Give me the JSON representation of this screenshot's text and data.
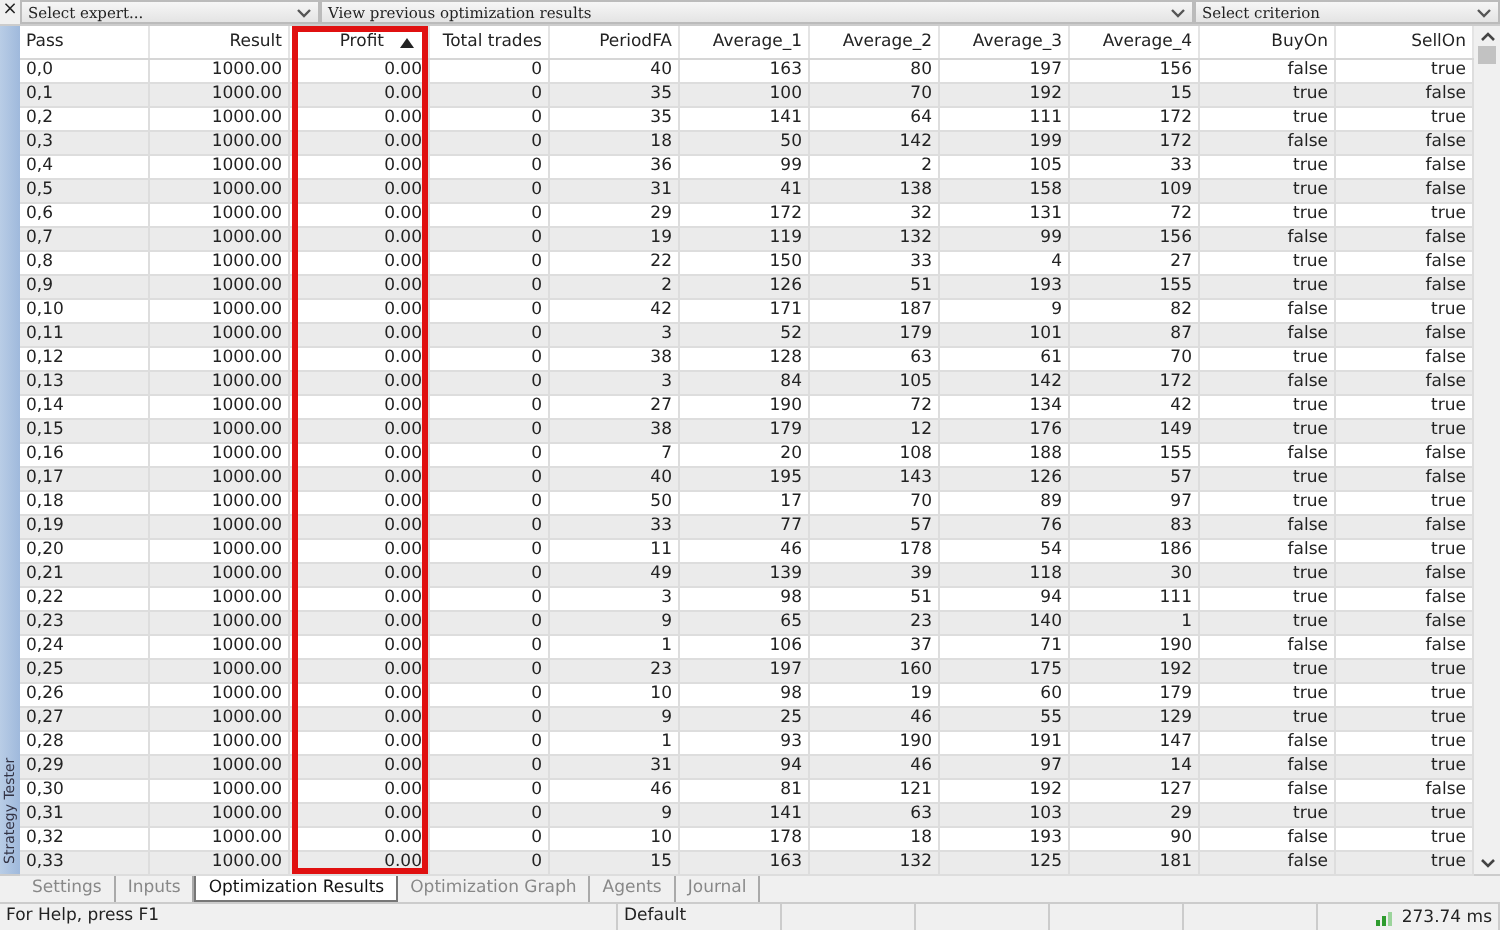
{
  "toolbar": {
    "close": "×",
    "expert_select": "Select expert...",
    "history_select": "View previous optimization results",
    "criterion_select": "Select criterion"
  },
  "side_label": "Strategy Tester",
  "table": {
    "columns": [
      {
        "label": "Pass",
        "sorted": false,
        "highlighted": false
      },
      {
        "label": "Result",
        "sorted": false,
        "highlighted": false
      },
      {
        "label": "Profit",
        "sorted": true,
        "highlighted": true
      },
      {
        "label": "Total trades",
        "sorted": false,
        "highlighted": false
      },
      {
        "label": "PeriodFA",
        "sorted": false,
        "highlighted": false
      },
      {
        "label": "Average_1",
        "sorted": false,
        "highlighted": false
      },
      {
        "label": "Average_2",
        "sorted": false,
        "highlighted": false
      },
      {
        "label": "Average_3",
        "sorted": false,
        "highlighted": false
      },
      {
        "label": "Average_4",
        "sorted": false,
        "highlighted": false
      },
      {
        "label": "BuyOn",
        "sorted": false,
        "highlighted": false
      },
      {
        "label": "SellOn",
        "sorted": false,
        "highlighted": false
      }
    ],
    "rows": [
      [
        "0,0",
        "1000.00",
        "0.00",
        "0",
        "40",
        "163",
        "80",
        "197",
        "156",
        "false",
        "true"
      ],
      [
        "0,1",
        "1000.00",
        "0.00",
        "0",
        "35",
        "100",
        "70",
        "192",
        "15",
        "true",
        "false"
      ],
      [
        "0,2",
        "1000.00",
        "0.00",
        "0",
        "35",
        "141",
        "64",
        "111",
        "172",
        "true",
        "true"
      ],
      [
        "0,3",
        "1000.00",
        "0.00",
        "0",
        "18",
        "50",
        "142",
        "199",
        "172",
        "false",
        "false"
      ],
      [
        "0,4",
        "1000.00",
        "0.00",
        "0",
        "36",
        "99",
        "2",
        "105",
        "33",
        "true",
        "false"
      ],
      [
        "0,5",
        "1000.00",
        "0.00",
        "0",
        "31",
        "41",
        "138",
        "158",
        "109",
        "true",
        "false"
      ],
      [
        "0,6",
        "1000.00",
        "0.00",
        "0",
        "29",
        "172",
        "32",
        "131",
        "72",
        "true",
        "true"
      ],
      [
        "0,7",
        "1000.00",
        "0.00",
        "0",
        "19",
        "119",
        "132",
        "99",
        "156",
        "false",
        "false"
      ],
      [
        "0,8",
        "1000.00",
        "0.00",
        "0",
        "22",
        "150",
        "33",
        "4",
        "27",
        "true",
        "false"
      ],
      [
        "0,9",
        "1000.00",
        "0.00",
        "0",
        "2",
        "126",
        "51",
        "193",
        "155",
        "true",
        "false"
      ],
      [
        "0,10",
        "1000.00",
        "0.00",
        "0",
        "42",
        "171",
        "187",
        "9",
        "82",
        "false",
        "true"
      ],
      [
        "0,11",
        "1000.00",
        "0.00",
        "0",
        "3",
        "52",
        "179",
        "101",
        "87",
        "false",
        "false"
      ],
      [
        "0,12",
        "1000.00",
        "0.00",
        "0",
        "38",
        "128",
        "63",
        "61",
        "70",
        "true",
        "false"
      ],
      [
        "0,13",
        "1000.00",
        "0.00",
        "0",
        "3",
        "84",
        "105",
        "142",
        "172",
        "false",
        "false"
      ],
      [
        "0,14",
        "1000.00",
        "0.00",
        "0",
        "27",
        "190",
        "72",
        "134",
        "42",
        "true",
        "true"
      ],
      [
        "0,15",
        "1000.00",
        "0.00",
        "0",
        "38",
        "179",
        "12",
        "176",
        "149",
        "true",
        "true"
      ],
      [
        "0,16",
        "1000.00",
        "0.00",
        "0",
        "7",
        "20",
        "108",
        "188",
        "155",
        "false",
        "false"
      ],
      [
        "0,17",
        "1000.00",
        "0.00",
        "0",
        "40",
        "195",
        "143",
        "126",
        "57",
        "true",
        "false"
      ],
      [
        "0,18",
        "1000.00",
        "0.00",
        "0",
        "50",
        "17",
        "70",
        "89",
        "97",
        "true",
        "true"
      ],
      [
        "0,19",
        "1000.00",
        "0.00",
        "0",
        "33",
        "77",
        "57",
        "76",
        "83",
        "false",
        "false"
      ],
      [
        "0,20",
        "1000.00",
        "0.00",
        "0",
        "11",
        "46",
        "178",
        "54",
        "186",
        "false",
        "true"
      ],
      [
        "0,21",
        "1000.00",
        "0.00",
        "0",
        "49",
        "139",
        "39",
        "118",
        "30",
        "true",
        "false"
      ],
      [
        "0,22",
        "1000.00",
        "0.00",
        "0",
        "3",
        "98",
        "51",
        "94",
        "111",
        "true",
        "false"
      ],
      [
        "0,23",
        "1000.00",
        "0.00",
        "0",
        "9",
        "65",
        "23",
        "140",
        "1",
        "true",
        "false"
      ],
      [
        "0,24",
        "1000.00",
        "0.00",
        "0",
        "1",
        "106",
        "37",
        "71",
        "190",
        "false",
        "false"
      ],
      [
        "0,25",
        "1000.00",
        "0.00",
        "0",
        "23",
        "197",
        "160",
        "175",
        "192",
        "true",
        "true"
      ],
      [
        "0,26",
        "1000.00",
        "0.00",
        "0",
        "10",
        "98",
        "19",
        "60",
        "179",
        "true",
        "true"
      ],
      [
        "0,27",
        "1000.00",
        "0.00",
        "0",
        "9",
        "25",
        "46",
        "55",
        "129",
        "true",
        "true"
      ],
      [
        "0,28",
        "1000.00",
        "0.00",
        "0",
        "1",
        "93",
        "190",
        "191",
        "147",
        "false",
        "true"
      ],
      [
        "0,29",
        "1000.00",
        "0.00",
        "0",
        "31",
        "94",
        "46",
        "97",
        "14",
        "false",
        "true"
      ],
      [
        "0,30",
        "1000.00",
        "0.00",
        "0",
        "46",
        "81",
        "121",
        "192",
        "127",
        "false",
        "false"
      ],
      [
        "0,31",
        "1000.00",
        "0.00",
        "0",
        "9",
        "141",
        "63",
        "103",
        "29",
        "true",
        "true"
      ],
      [
        "0,32",
        "1000.00",
        "0.00",
        "0",
        "10",
        "178",
        "18",
        "193",
        "90",
        "false",
        "true"
      ],
      [
        "0,33",
        "1000.00",
        "0.00",
        "0",
        "15",
        "163",
        "132",
        "125",
        "181",
        "false",
        "true"
      ]
    ]
  },
  "tabs": [
    {
      "label": "Settings",
      "selected": false
    },
    {
      "label": "Inputs",
      "selected": false
    },
    {
      "label": "Optimization Results",
      "selected": true
    },
    {
      "label": "Optimization Graph",
      "selected": false
    },
    {
      "label": "Agents",
      "selected": false
    },
    {
      "label": "Journal",
      "selected": false
    }
  ],
  "status_bar": {
    "help": "For Help, press F1",
    "profile": "Default",
    "ping": "273.74 ms"
  }
}
